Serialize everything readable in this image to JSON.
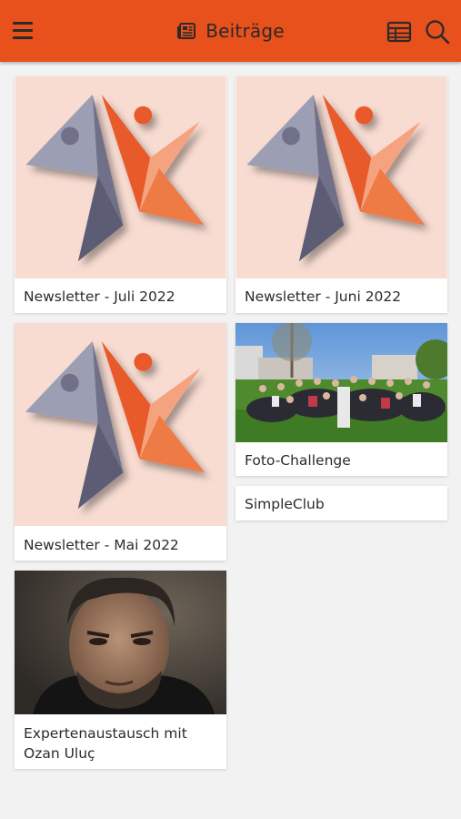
{
  "header": {
    "title": "Beiträge",
    "menu_icon": "hamburger-menu-icon",
    "title_icon": "newspaper-icon",
    "table_icon": "table-view-icon",
    "search_icon": "search-icon",
    "background_color": "#e8501c"
  },
  "posts": [
    {
      "title": "Newsletter - Juli 2022",
      "image": "newsletter-logo"
    },
    {
      "title": "Newsletter - Juni 2022",
      "image": "newsletter-logo"
    },
    {
      "title": "Newsletter - Mai 2022",
      "image": "newsletter-logo"
    },
    {
      "title": "Foto-Challenge",
      "image": "group-photo"
    },
    {
      "title": "SimpleClub"
    },
    {
      "title": "Expertenaustausch mit Ozan Uluç",
      "image": "portrait-photo"
    }
  ],
  "colors": {
    "logo_background": "#f8dcd2",
    "logo_gray": "#6f7189",
    "logo_orange": "#e85a2a",
    "logo_peach": "#f5a37f"
  }
}
